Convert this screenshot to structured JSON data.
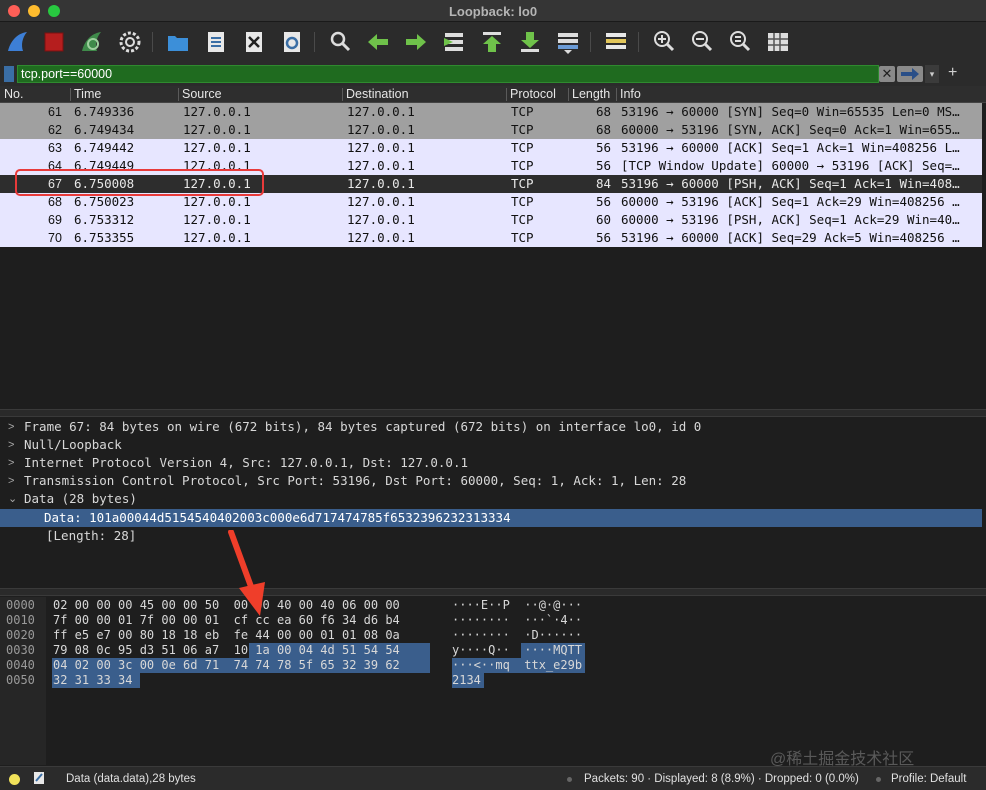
{
  "window": {
    "title": "Loopback: lo0"
  },
  "toolbar": {
    "icons": [
      "shark-fin-start-icon",
      "stop-capture-icon",
      "restart-capture-icon",
      "capture-options-icon",
      "open-file-icon",
      "save-file-icon",
      "close-file-icon",
      "reload-file-icon",
      "find-packet-icon",
      "go-back-icon",
      "go-forward-icon",
      "go-to-packet-icon",
      "go-first-icon",
      "go-last-icon",
      "autoscroll-icon",
      "colorize-icon",
      "zoom-in-icon",
      "zoom-out-icon",
      "normal-size-icon",
      "resize-columns-icon"
    ]
  },
  "filter": {
    "value": "tcp.port==60000",
    "clear_label": "✕"
  },
  "packet_list": {
    "columns": [
      "No.",
      "Time",
      "Source",
      "Destination",
      "Protocol",
      "Length",
      "Info"
    ],
    "rows": [
      {
        "no": "61",
        "time": "6.749336",
        "src": "127.0.0.1",
        "dst": "127.0.0.1",
        "proto": "TCP",
        "len": "68",
        "info": "53196 → 60000 [SYN] Seq=0 Win=65535 Len=0 MS…"
      },
      {
        "no": "62",
        "time": "6.749434",
        "src": "127.0.0.1",
        "dst": "127.0.0.1",
        "proto": "TCP",
        "len": "68",
        "info": "60000 → 53196 [SYN, ACK] Seq=0 Ack=1 Win=655…"
      },
      {
        "no": "63",
        "time": "6.749442",
        "src": "127.0.0.1",
        "dst": "127.0.0.1",
        "proto": "TCP",
        "len": "56",
        "info": "53196 → 60000 [ACK] Seq=1 Ack=1 Win=408256 L…"
      },
      {
        "no": "64",
        "time": "6.749449",
        "src": "127.0.0.1",
        "dst": "127.0.0.1",
        "proto": "TCP",
        "len": "56",
        "info": "[TCP Window Update] 60000 → 53196 [ACK] Seq=…"
      },
      {
        "no": "67",
        "time": "6.750008",
        "src": "127.0.0.1",
        "dst": "127.0.0.1",
        "proto": "TCP",
        "len": "84",
        "info": "53196 → 60000 [PSH, ACK] Seq=1 Ack=1 Win=408…"
      },
      {
        "no": "68",
        "time": "6.750023",
        "src": "127.0.0.1",
        "dst": "127.0.0.1",
        "proto": "TCP",
        "len": "56",
        "info": "60000 → 53196 [ACK] Seq=1 Ack=29 Win=408256 …"
      },
      {
        "no": "69",
        "time": "6.753312",
        "src": "127.0.0.1",
        "dst": "127.0.0.1",
        "proto": "TCP",
        "len": "60",
        "info": "60000 → 53196 [PSH, ACK] Seq=1 Ack=29 Win=40…"
      },
      {
        "no": "70",
        "time": "6.753355",
        "src": "127.0.0.1",
        "dst": "127.0.0.1",
        "proto": "TCP",
        "len": "56",
        "info": "53196 → 60000 [ACK] Seq=29 Ack=5 Win=408256 …"
      }
    ]
  },
  "detail": {
    "items": [
      {
        "chev": ">",
        "text": "Frame 67: 84 bytes on wire (672 bits), 84 bytes captured (672 bits) on interface lo0, id 0"
      },
      {
        "chev": ">",
        "text": "Null/Loopback"
      },
      {
        "chev": ">",
        "text": "Internet Protocol Version 4, Src: 127.0.0.1, Dst: 127.0.0.1"
      },
      {
        "chev": ">",
        "text": "Transmission Control Protocol, Src Port: 53196, Dst Port: 60000, Seq: 1, Ack: 1, Len: 28"
      },
      {
        "chev": "⌄",
        "text": "Data (28 bytes)"
      },
      {
        "chev": "",
        "text": "Data: 101a00044d5154540402003c000e6d717474785f6532396232313334"
      },
      {
        "chev": "",
        "text": "[Length: 28]"
      }
    ]
  },
  "bytes": {
    "offsets": [
      "0000",
      "0010",
      "0020",
      "0030",
      "0040",
      "0050"
    ],
    "hex": [
      "02 00 00 00 45 00 00 50  00 00 40 00 40 06 00 00",
      "7f 00 00 01 7f 00 00 01  cf cc ea 60 f6 34 d6 b4",
      "ff e5 e7 00 80 18 18 eb  fe 44 00 00 01 01 08 0a",
      "79 08 0c 95 d3 51 06 a7  10 1a 00 04 4d 51 54 54",
      "04 02 00 3c 00 0e 6d 71  74 74 78 5f 65 32 39 62",
      "32 31 33 34"
    ],
    "ascii": [
      "····E··P  ··@·@···",
      "········  ···`·4··",
      "········  ·D······",
      "y····Q··  ····MQTT",
      "···<··mq  ttx_e29b",
      "2134"
    ]
  },
  "status": {
    "field": "Data (data.data),28 bytes",
    "packets": "Packets: 90 · Displayed: 8 (8.9%) · Dropped: 0 (0.0%)",
    "profile": "Profile: Default"
  },
  "watermark": "@稀土掘金技术社区",
  "colors": {
    "syn_row": "#a0a0a0",
    "tcp_row": "#e7e6ff",
    "selection": "#3a5e8c",
    "filter_ok": "#1f6b1f",
    "annotation": "#e83a3a"
  }
}
